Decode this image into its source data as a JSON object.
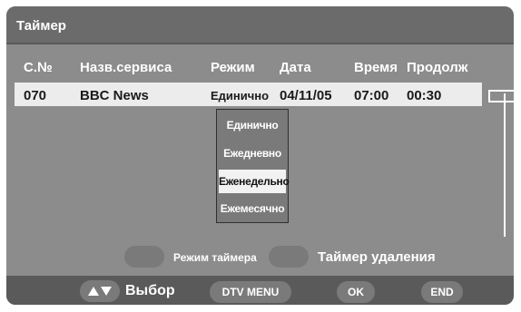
{
  "title": "Таймер",
  "columns": {
    "number": "С.№",
    "service": "Назв.сервиса",
    "mode": "Режим",
    "date": "Дата",
    "time": "Время",
    "duration": "Продолж"
  },
  "row": {
    "number": "070",
    "service": "BBC News",
    "mode": "Единично",
    "date": "04/11/05",
    "time": "07:00",
    "duration": "00:30"
  },
  "dropdown": {
    "options": [
      "Единично",
      "Ежедневно",
      "Еженедельно",
      "Ежемесячно"
    ],
    "selected": "Еженедельно"
  },
  "legend": {
    "timer_mode": "Режим таймера",
    "delete_timer": "Таймер удаления"
  },
  "footer": {
    "select": "Выбор",
    "dtv_menu": "DTV MENU",
    "ok": "OK",
    "end": "END"
  },
  "colors": {
    "panel": "#8c8c8c",
    "titlebar": "#6b6b6b",
    "footer": "#5a5a5a",
    "row_highlight": "#ececec"
  }
}
